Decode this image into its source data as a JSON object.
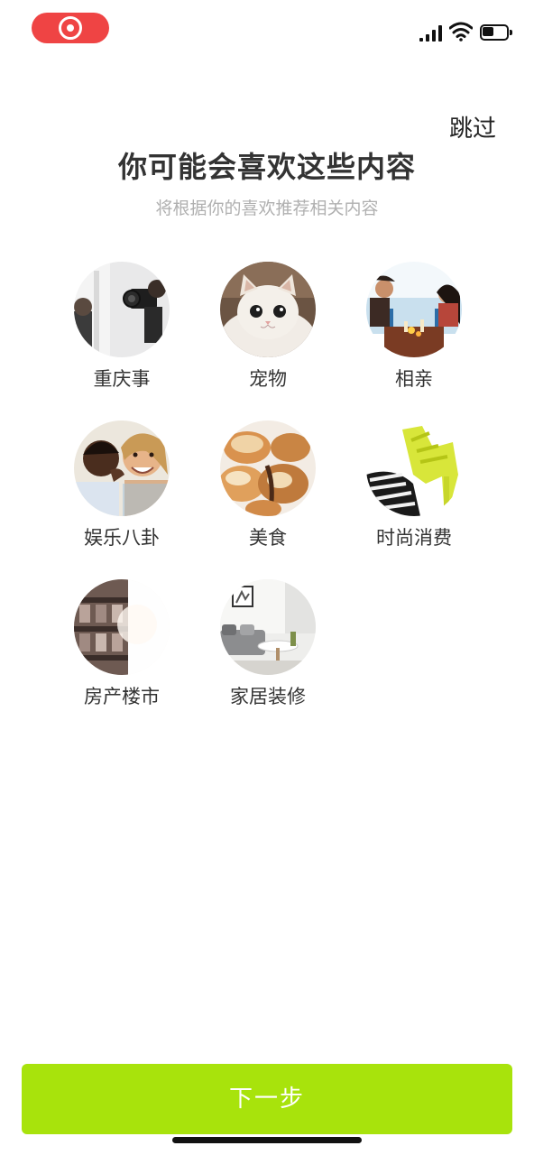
{
  "header": {
    "skip_label": "跳过",
    "title": "你可能会喜欢这些内容",
    "subtitle": "将根据你的喜欢推荐相关内容"
  },
  "interests": [
    {
      "label": "重庆事",
      "icon": "camera-photo"
    },
    {
      "label": "宠物",
      "icon": "cat-photo"
    },
    {
      "label": "相亲",
      "icon": "couple-dinner-photo"
    },
    {
      "label": "娱乐八卦",
      "icon": "whisper-gossip-photo"
    },
    {
      "label": "美食",
      "icon": "pastry-photo"
    },
    {
      "label": "时尚消费",
      "icon": "high-heel-photo"
    },
    {
      "label": "房产楼市",
      "icon": "building-photo"
    },
    {
      "label": "家居装修",
      "icon": "living-room-photo"
    }
  ],
  "footer": {
    "next_label": "下一步"
  },
  "colors": {
    "accent": "#a8e30c",
    "recording": "#ef4444",
    "title": "#333333",
    "subtitle": "#b0b0b0"
  }
}
